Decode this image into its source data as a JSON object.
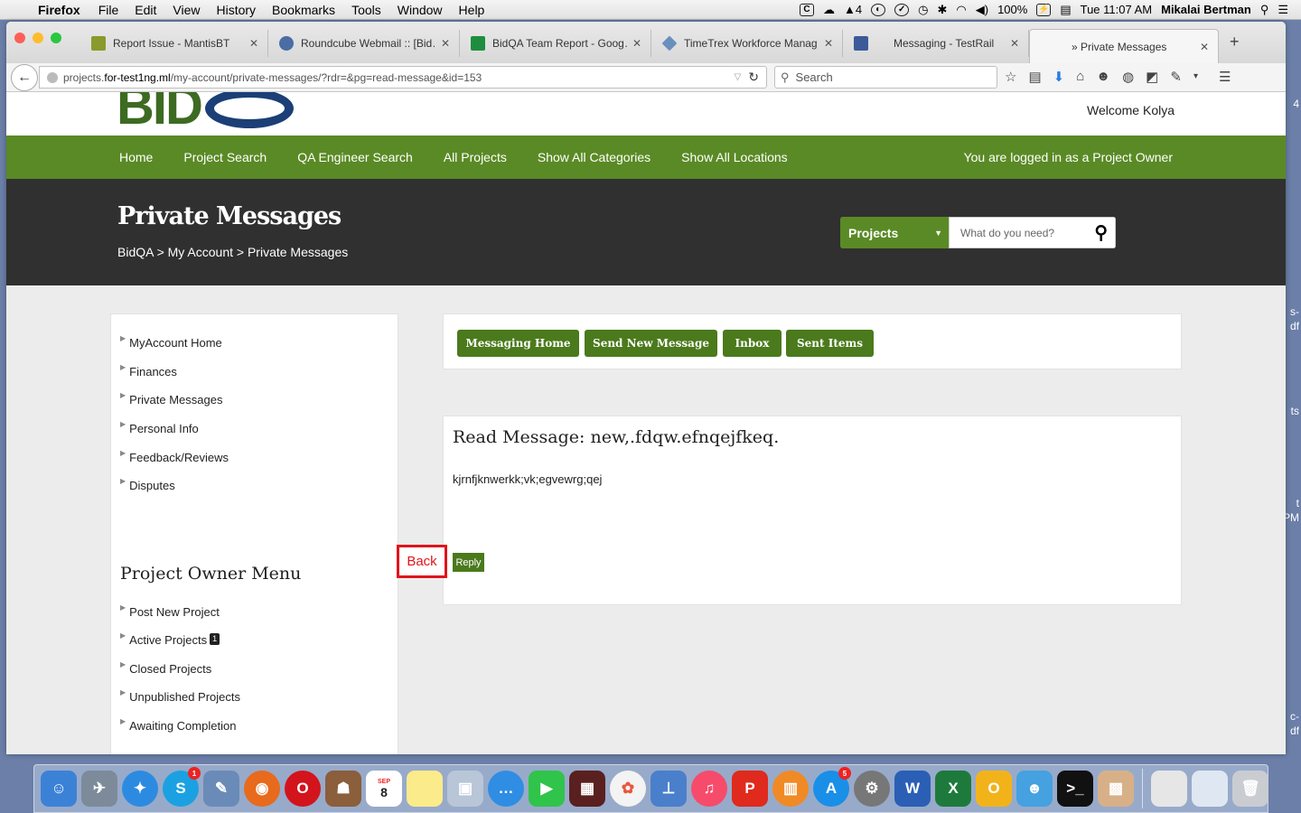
{
  "menubar": {
    "app": "Firefox",
    "items": [
      "File",
      "Edit",
      "View",
      "History",
      "Bookmarks",
      "Tools",
      "Window",
      "Help"
    ],
    "adobe_count": "4",
    "battery": "100%",
    "clock": "Tue 11:07 AM",
    "user": "Mikalai Bertman"
  },
  "desktop_side": {
    "t1": "4",
    "t2": "s-",
    "t3": "df",
    "t4": "ts",
    "t5": "t",
    "t6": "PM",
    "t7": "c-",
    "t8": "df"
  },
  "tabs": [
    {
      "title": "Report Issue - MantisBT",
      "icon_color": "#8a9a2c"
    },
    {
      "title": "Roundcube Webmail :: [Bid…",
      "icon_color": "#4a6da3"
    },
    {
      "title": "BidQA Team Report - Goog…",
      "icon_color": "#1e8e3e"
    },
    {
      "title": "TimeTrex Workforce Manag…",
      "icon_color": "#6a8fbd"
    },
    {
      "title": "Messaging - TestRail",
      "icon_color": "#3c5a99"
    },
    {
      "title": "» Private Messages",
      "icon_color": ""
    }
  ],
  "url": {
    "prefix": "projects.",
    "host": "for-test1ng.ml",
    "path": "/my-account/private-messages/?rdr=&pg=read-message&id=153"
  },
  "browser_search_placeholder": "Search",
  "site": {
    "welcome": "Welcome Kolya",
    "nav": [
      "Home",
      "Project Search",
      "QA Engineer Search",
      "All Projects",
      "Show All Categories",
      "Show All Locations"
    ],
    "logged_in": "You are logged in as a Project Owner",
    "page_title": "Private Messages",
    "breadcrumb": "BidQA > My Account > Private Messages",
    "search_select": "Projects",
    "search_placeholder": "What do you need?",
    "account_menu": [
      "MyAccount Home",
      "Finances",
      "Private Messages",
      "Personal Info",
      "Feedback/Reviews",
      "Disputes"
    ],
    "owner_menu_title": "Project Owner Menu",
    "owner_menu": [
      "Post New Project",
      "Active Projects",
      "Closed Projects",
      "Unpublished Projects",
      "Awaiting Completion"
    ],
    "active_projects_badge": "1",
    "msg_tabs": [
      "Messaging Home",
      "Send New Message",
      "Inbox",
      "Sent Items"
    ],
    "message_title": "Read Message: new,.fdqw.efnqejfkeq.",
    "message_body": "kjrnfjknwerkk;vk;egvewrg;qej",
    "back_label": "Back",
    "reply_label": "Reply"
  },
  "dock": {
    "skype_badge": "1",
    "appstore_badge": "5",
    "calendar_month": "SEP",
    "calendar_day": "8"
  },
  "colors": {
    "brand_green": "#5a8a25",
    "dark_band": "#303030",
    "highlight_red": "#e0141b"
  }
}
